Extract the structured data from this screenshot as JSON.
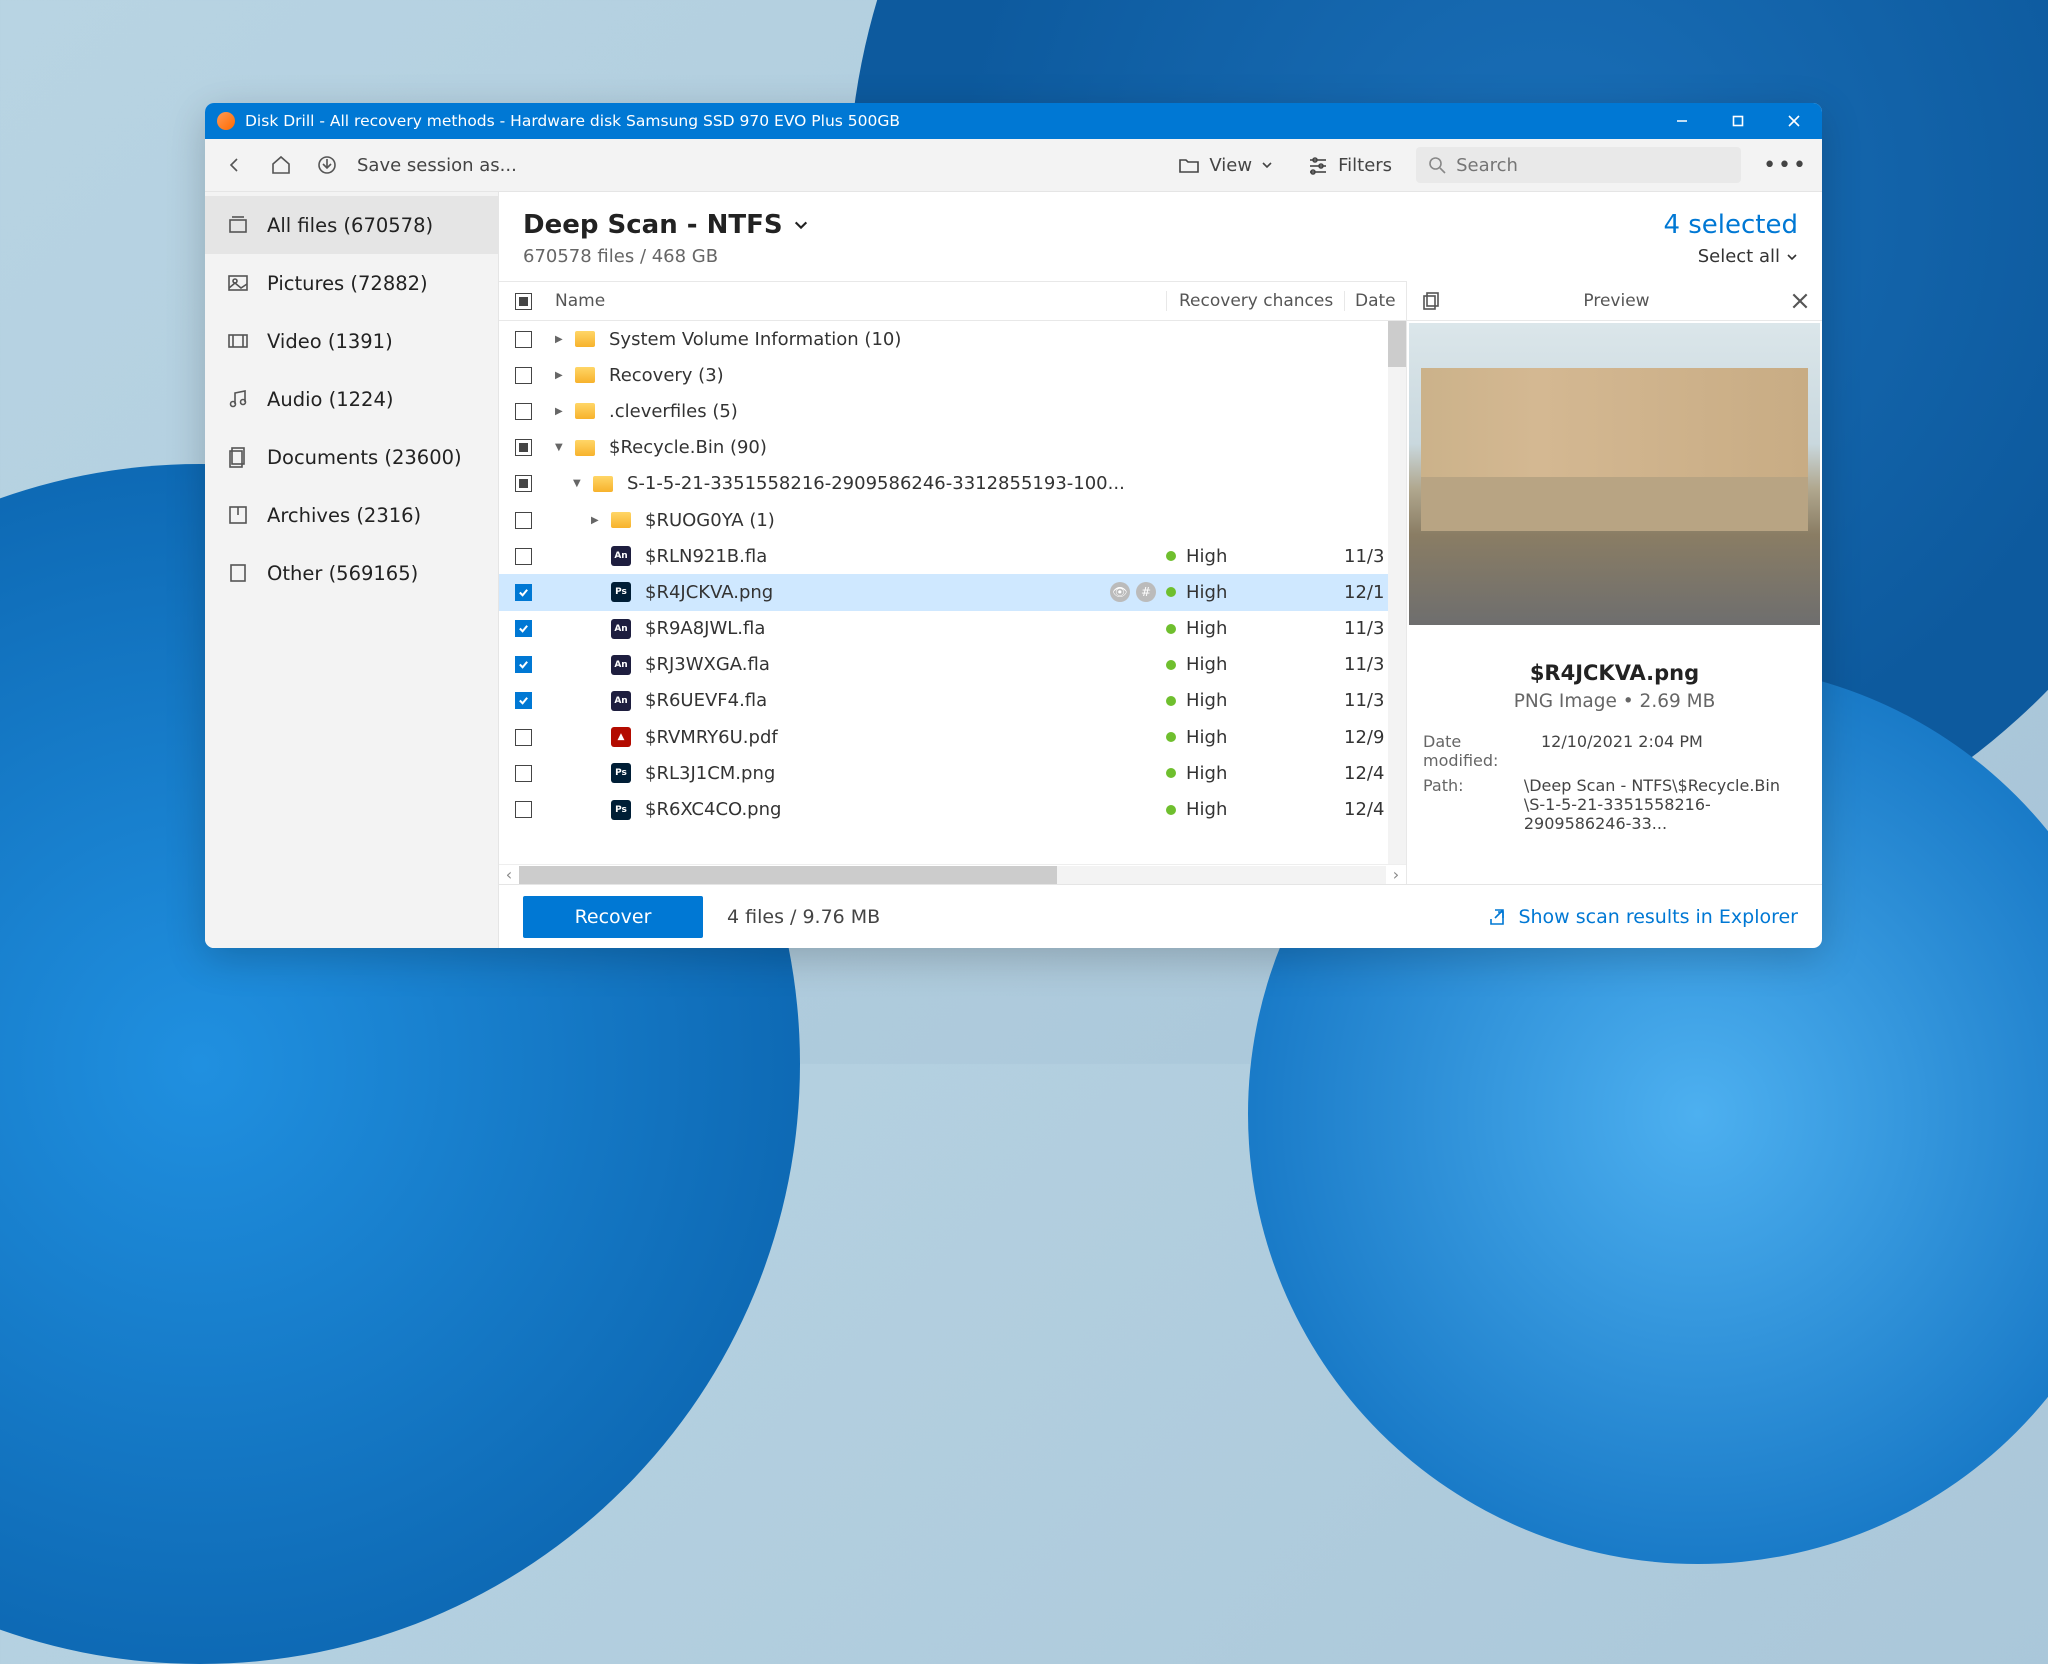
{
  "titlebar": {
    "title": "Disk Drill - All recovery methods - Hardware disk Samsung SSD 970 EVO Plus 500GB"
  },
  "toolbar": {
    "save_session_label": "Save session as...",
    "view_label": "View",
    "filters_label": "Filters",
    "search_placeholder": "Search"
  },
  "sidebar": {
    "items": [
      {
        "label": "All files (670578)"
      },
      {
        "label": "Pictures (72882)"
      },
      {
        "label": "Video (1391)"
      },
      {
        "label": "Audio (1224)"
      },
      {
        "label": "Documents (23600)"
      },
      {
        "label": "Archives (2316)"
      },
      {
        "label": "Other (569165)"
      }
    ]
  },
  "main": {
    "scan_title": "Deep Scan - NTFS",
    "summary": "670578 files / 468 GB",
    "selected_label": "4 selected",
    "select_all_label": "Select all"
  },
  "columns": {
    "name": "Name",
    "recovery": "Recovery chances",
    "date": "Date"
  },
  "rows": [
    {
      "check": "empty",
      "indent": 0,
      "caret": "right",
      "icon": "folder",
      "name": "System Volume Information (10)",
      "recovery": "",
      "date": ""
    },
    {
      "check": "empty",
      "indent": 0,
      "caret": "right",
      "icon": "folder",
      "name": "Recovery (3)",
      "recovery": "",
      "date": ""
    },
    {
      "check": "empty",
      "indent": 0,
      "caret": "right",
      "icon": "folder",
      "name": ".cleverfiles (5)",
      "recovery": "",
      "date": ""
    },
    {
      "check": "partial",
      "indent": 0,
      "caret": "down",
      "icon": "folder",
      "name": "$Recycle.Bin (90)",
      "recovery": "",
      "date": ""
    },
    {
      "check": "partial",
      "indent": 1,
      "caret": "down",
      "icon": "folder",
      "name": "S-1-5-21-3351558216-2909586246-3312855193-100...",
      "recovery": "",
      "date": ""
    },
    {
      "check": "empty",
      "indent": 2,
      "caret": "right",
      "icon": "folder",
      "name": "$RUOG0YA (1)",
      "recovery": "",
      "date": ""
    },
    {
      "check": "empty",
      "indent": 2,
      "caret": "",
      "icon": "an",
      "name": "$RLN921B.fla",
      "recovery": "High",
      "date": "11/3"
    },
    {
      "check": "checked",
      "indent": 2,
      "caret": "",
      "icon": "ps",
      "name": "$R4JCKVA.png",
      "recovery": "High",
      "date": "12/1",
      "sel": true,
      "badges": true
    },
    {
      "check": "checked",
      "indent": 2,
      "caret": "",
      "icon": "an",
      "name": "$R9A8JWL.fla",
      "recovery": "High",
      "date": "11/3"
    },
    {
      "check": "checked",
      "indent": 2,
      "caret": "",
      "icon": "an",
      "name": "$RJ3WXGA.fla",
      "recovery": "High",
      "date": "11/3"
    },
    {
      "check": "checked",
      "indent": 2,
      "caret": "",
      "icon": "an",
      "name": "$R6UEVF4.fla",
      "recovery": "High",
      "date": "11/3"
    },
    {
      "check": "empty",
      "indent": 2,
      "caret": "",
      "icon": "pdf",
      "name": "$RVMRY6U.pdf",
      "recovery": "High",
      "date": "12/9"
    },
    {
      "check": "empty",
      "indent": 2,
      "caret": "",
      "icon": "ps",
      "name": "$RL3J1CM.png",
      "recovery": "High",
      "date": "12/4"
    },
    {
      "check": "empty",
      "indent": 2,
      "caret": "",
      "icon": "ps",
      "name": "$R6XC4CO.png",
      "recovery": "High",
      "date": "12/4"
    }
  ],
  "preview": {
    "header": "Preview",
    "filename": "$R4JCKVA.png",
    "meta": "PNG Image • 2.69 MB",
    "date_modified_label": "Date modified:",
    "date_modified": "12/10/2021 2:04 PM",
    "path_label": "Path:",
    "path_1": "\\Deep Scan - NTFS\\$Recycle.Bin",
    "path_2": "\\S-1-5-21-3351558216-2909586246-33..."
  },
  "footer": {
    "recover_label": "Recover",
    "status": "4 files / 9.76 MB",
    "explorer_link": "Show scan results in Explorer"
  }
}
